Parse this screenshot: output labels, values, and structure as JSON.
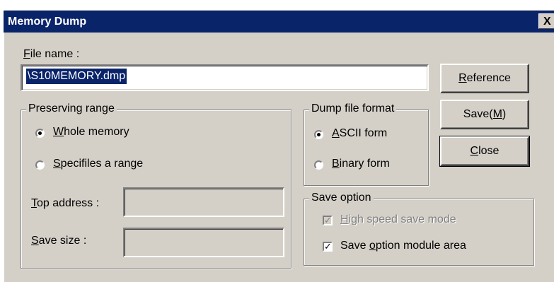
{
  "window": {
    "title": "Memory Dump",
    "close_glyph": "X"
  },
  "file_name": {
    "label_accel": "F",
    "label_rest": "ile name :",
    "value": "\\S10MEMORY.dmp"
  },
  "buttons": {
    "reference_accel": "R",
    "reference_rest": "eference",
    "save_pre": "Save(",
    "save_accel": "M",
    "save_post": ")",
    "close_accel": "C",
    "close_rest": "lose"
  },
  "preserving_range": {
    "title": "Preserving range",
    "options": [
      {
        "accel": "W",
        "rest": "hole memory",
        "selected": true
      },
      {
        "accel": "S",
        "rest": "pecifiles a range",
        "selected": false
      }
    ],
    "top_address": {
      "accel": "T",
      "rest": "op address :",
      "value": ""
    },
    "save_size": {
      "accel": "S",
      "rest": "ave size :",
      "value": ""
    }
  },
  "dump_format": {
    "title": "Dump file format",
    "options": [
      {
        "accel": "A",
        "rest": "SCII form",
        "selected": true
      },
      {
        "accel": "B",
        "rest": "inary form",
        "selected": false
      }
    ]
  },
  "save_option": {
    "title": "Save option",
    "items": [
      {
        "accel": "H",
        "rest": "igh speed save mode",
        "checked": true,
        "disabled": true
      },
      {
        "pre": "Save ",
        "accel": "o",
        "rest": "ption module area",
        "checked": true,
        "disabled": false
      }
    ]
  }
}
